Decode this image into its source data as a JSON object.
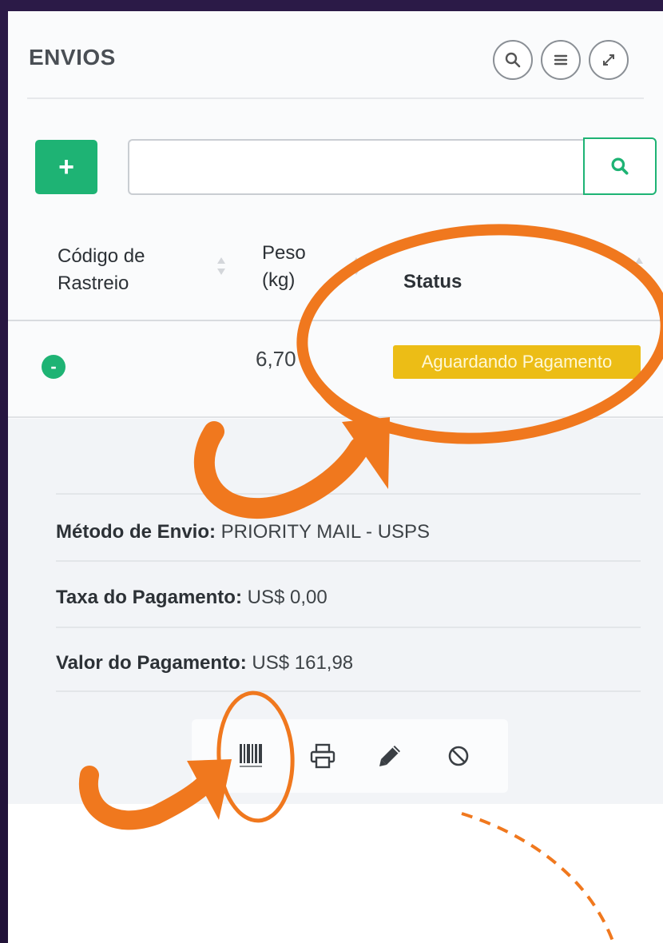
{
  "header": {
    "title": "ENVIOS",
    "buttons": [
      {
        "name": "search-icon"
      },
      {
        "name": "menu-icon"
      },
      {
        "name": "expand-icon"
      }
    ]
  },
  "toolbar": {
    "add_label": "+",
    "search_placeholder": "",
    "search_value": ""
  },
  "table": {
    "columns": [
      "Código de Rastreio",
      "Peso (kg)",
      "Status"
    ],
    "column_lines": [
      [
        "Código de",
        "Rastreio"
      ],
      [
        "Peso",
        "(kg)"
      ],
      [
        "Status"
      ]
    ],
    "rows": [
      {
        "expand_label": "-",
        "code": "",
        "weight": "6,70",
        "status": "Aguardando Pagamento"
      }
    ]
  },
  "details": {
    "shipping_method_label": "Método de Envio:",
    "shipping_method_value": "PRIORITY MAIL - USPS",
    "payment_fee_label": "Taxa do Pagamento:",
    "payment_fee_value": "US$ 0,00",
    "payment_amount_label": "Valor do Pagamento:",
    "payment_amount_value": "US$ 161,98"
  },
  "actions": [
    {
      "name": "barcode-icon"
    },
    {
      "name": "printer-icon"
    },
    {
      "name": "pencil-icon"
    },
    {
      "name": "cancel-icon"
    }
  ],
  "colors": {
    "accent_green": "#1eb374",
    "status_yellow": "#ecbd16",
    "annotation_orange": "#f0781e",
    "background_purple": "#2b1a47"
  }
}
